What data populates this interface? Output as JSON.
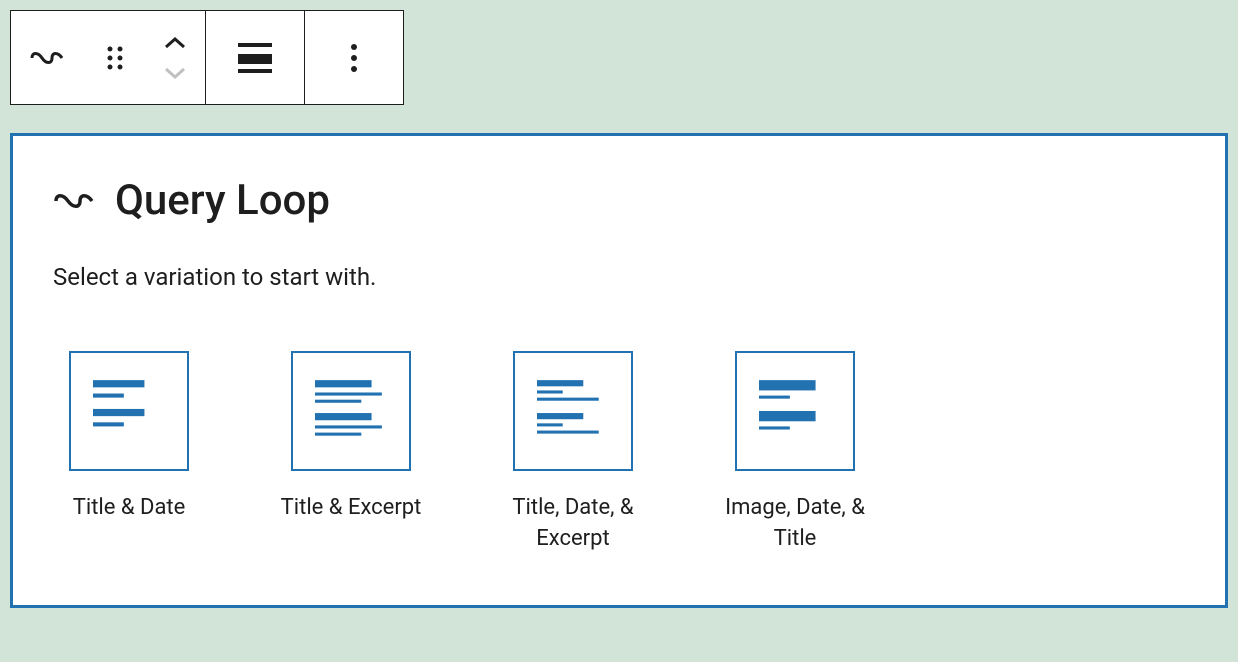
{
  "toolbar": {
    "block_type_icon": "query-loop-icon",
    "drag_icon": "drag-handle-icon",
    "move_up_icon": "chevron-up-icon",
    "move_down_icon": "chevron-down-icon",
    "align_icon": "align-icon",
    "more_icon": "more-vertical-icon"
  },
  "block": {
    "title": "Query Loop",
    "description": "Select a variation to start with."
  },
  "variations": [
    {
      "label": "Title & Date",
      "icon": "title-date"
    },
    {
      "label": "Title & Excerpt",
      "icon": "title-excerpt"
    },
    {
      "label": "Title, Date, & Excerpt",
      "icon": "title-date-excerpt"
    },
    {
      "label": "Image, Date, & Title",
      "icon": "image-date-title"
    }
  ]
}
